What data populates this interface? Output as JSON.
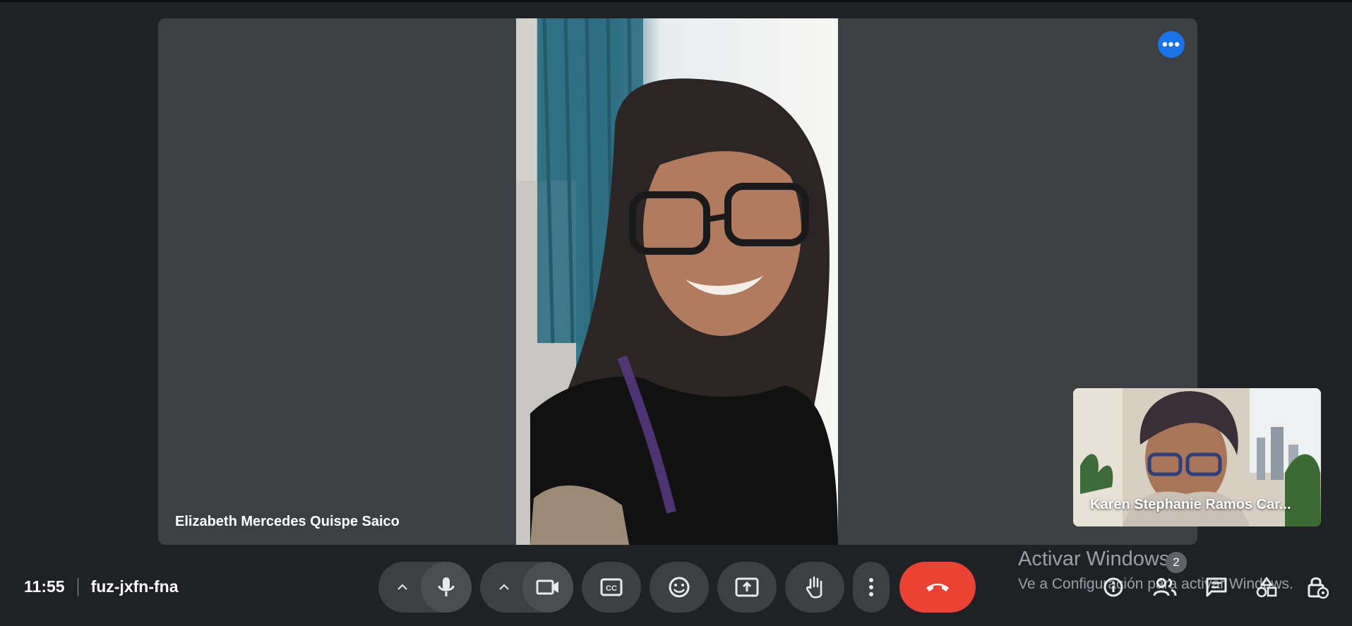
{
  "meeting": {
    "time": "11:55",
    "code": "fuz-jxfn-fna"
  },
  "participants": {
    "main": {
      "name": "Elizabeth Mercedes Quispe Saico"
    },
    "self": {
      "name": "Karen Stephanie Ramos Car..."
    }
  },
  "controls": {
    "mic": {
      "icon": "microphone-icon"
    },
    "camera": {
      "icon": "camera-icon"
    },
    "captions": {
      "icon": "closed-captions-icon"
    },
    "reactions": {
      "icon": "emoji-icon"
    },
    "present": {
      "icon": "present-screen-icon"
    },
    "raise_hand": {
      "icon": "raise-hand-icon"
    },
    "more": {
      "icon": "more-vert-icon"
    },
    "leave": {
      "icon": "end-call-icon",
      "color": "#ea4335"
    }
  },
  "right_panel": {
    "people_count": "2",
    "icons": [
      "info-icon",
      "people-icon",
      "chat-icon",
      "activities-icon",
      "host-controls-icon"
    ]
  },
  "watermark": {
    "title": "Activar Windows",
    "subtitle": "Ve a Configuración para activar Windows."
  },
  "colors": {
    "background": "#202124",
    "tile": "#3c4043",
    "accent": "#1a73e8",
    "danger": "#ea4335"
  }
}
